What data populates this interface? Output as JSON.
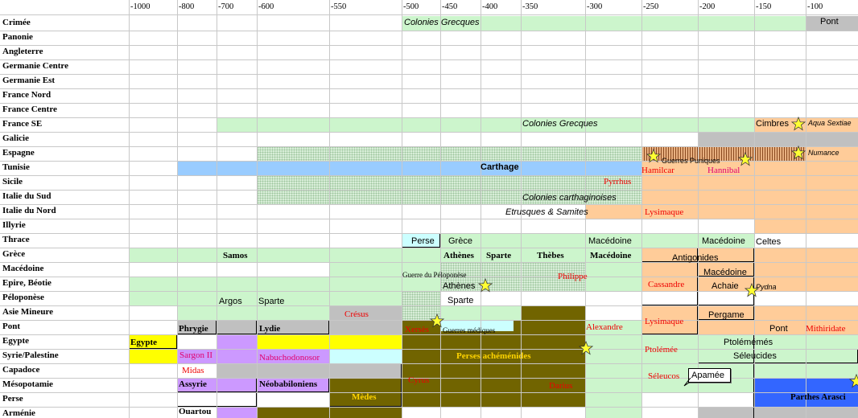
{
  "years": [
    "-1000",
    "-800",
    "-700",
    "-600",
    "-550",
    "-500",
    "-450",
    "-400",
    "-350",
    "-300",
    "-250",
    "-200",
    "-150",
    "-100"
  ],
  "rows": [
    "Crimée",
    "Panonie",
    "Angleterre",
    "Germanie Centre",
    "Germanie Est",
    "France Nord",
    "France Centre",
    "France SE",
    "Galicie",
    "Espagne",
    "Tunisie",
    "Sicile",
    "Italie du Sud",
    "Italie du Nord",
    "Illyrie",
    "Thrace",
    "Grèce",
    "Macédoine",
    "Epire, Béotie",
    "Péloponèse",
    "Asie Mineure",
    "Pont",
    "Egypte",
    "Syrie/Palestine",
    "Capadoce",
    "Mésopotamie",
    "Perse",
    "Arménie"
  ],
  "labels": {
    "colonies_grecques_crimee": "Colonies Grecques",
    "pont_top": "Pont",
    "colonies_grecques_france": "Colonies Grecques",
    "cimbres": "Cimbres",
    "aqua_sextiae": "Aqua Sextiae",
    "guerres_puniques": "Guerres Puniques",
    "numance": "Numance",
    "carthage": "Carthage",
    "hamilcar": "Hamilcar",
    "hannibal": "Hannibal",
    "pyrrhus": "Pyrrhus",
    "colonies_carthaginoises": "Colonies carthaginoises",
    "etrusques": "Etrusques & Samites",
    "lysimaque_it": "Lysimaque",
    "perse_thrace": "Perse",
    "grece_thrace": "Grèce",
    "macedoine_thrace1": "Macédoine",
    "macedoine_thrace2": "Macédoine",
    "celtes": "Celtes",
    "samos": "Samos",
    "athenes_b": "Athènes",
    "sparte_b": "Sparte",
    "thebes": "Thèbes",
    "macedoine_b": "Macédoine",
    "antigonides": "Antigonides",
    "macedoine_box": "Macédoine",
    "guerre_peloponese": "Guerre du Péloponèse",
    "philippe": "Philippe",
    "cassandre": "Cassandre",
    "athenes": "Athènes",
    "achaie": "Achaie",
    "pydna": "Pydna",
    "argos": "Argos",
    "sparte_pel": "Sparte",
    "sparte_p2": "Sparte",
    "cresus": "Crésus",
    "lysimaque_am": "Lysimaque",
    "pergame": "Pergame",
    "phrygie": "Phrygie",
    "lydie": "Lydie",
    "xerses": "Xersès",
    "guerres_mediques": "Guerres médiques",
    "alexandre": "Alexandre",
    "pont": "Pont",
    "mithridate": "Mithiridate",
    "egypte": "Egypte",
    "perses_achemenides": "Perses achéménides",
    "ptolemee": "Ptolémée",
    "ptolememes": "Ptolémémés",
    "sargon": "Sargon II",
    "nabuchodonosor": "Nabuchodonosor",
    "seleucides": "Séleucides",
    "midas": "Midas",
    "seleucos": "Séleucos",
    "apamee": "Apamée",
    "assyrie": "Assyrie",
    "neobabiloniens": "Néobabiloniens",
    "cyrus": "Cyrus",
    "darius": "Darius",
    "medes": "Mèdes",
    "parthes": "Parthes Arasci",
    "ouartou": "Ouartou"
  },
  "colors": {
    "light_green": "#ccf5cc",
    "blue": "#99ccff",
    "olive": "#716400",
    "grey": "#c0c0c0",
    "purple": "#cc99ff",
    "yellow": "#ffff00",
    "peach": "#ffcc99",
    "light_cyan": "#ccffff",
    "royal_blue": "#3366ff",
    "red": "#ff0000"
  }
}
